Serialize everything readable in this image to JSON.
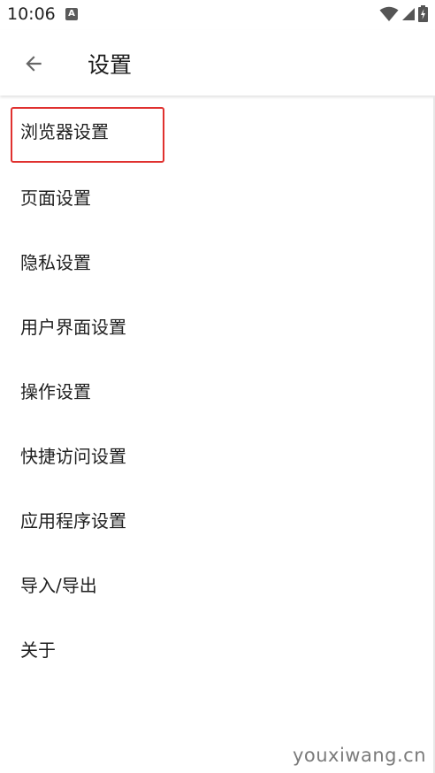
{
  "status_bar": {
    "time": "10:06",
    "notification_icon": "a-icon",
    "wifi_icon": "wifi-icon",
    "signal_icon": "signal-icon",
    "battery_icon": "battery-charging-icon"
  },
  "app_bar": {
    "back_icon": "arrow-left-icon",
    "title": "设置"
  },
  "menu": {
    "items": [
      {
        "label": "浏览器设置"
      },
      {
        "label": "页面设置"
      },
      {
        "label": "隐私设置"
      },
      {
        "label": "用户界面设置"
      },
      {
        "label": "操作设置"
      },
      {
        "label": "快捷访问设置"
      },
      {
        "label": "应用程序设置"
      },
      {
        "label": "导入/导出"
      },
      {
        "label": "关于"
      }
    ]
  },
  "highlight": {
    "color": "#e0312f"
  },
  "watermark": "youxiwang.cn"
}
